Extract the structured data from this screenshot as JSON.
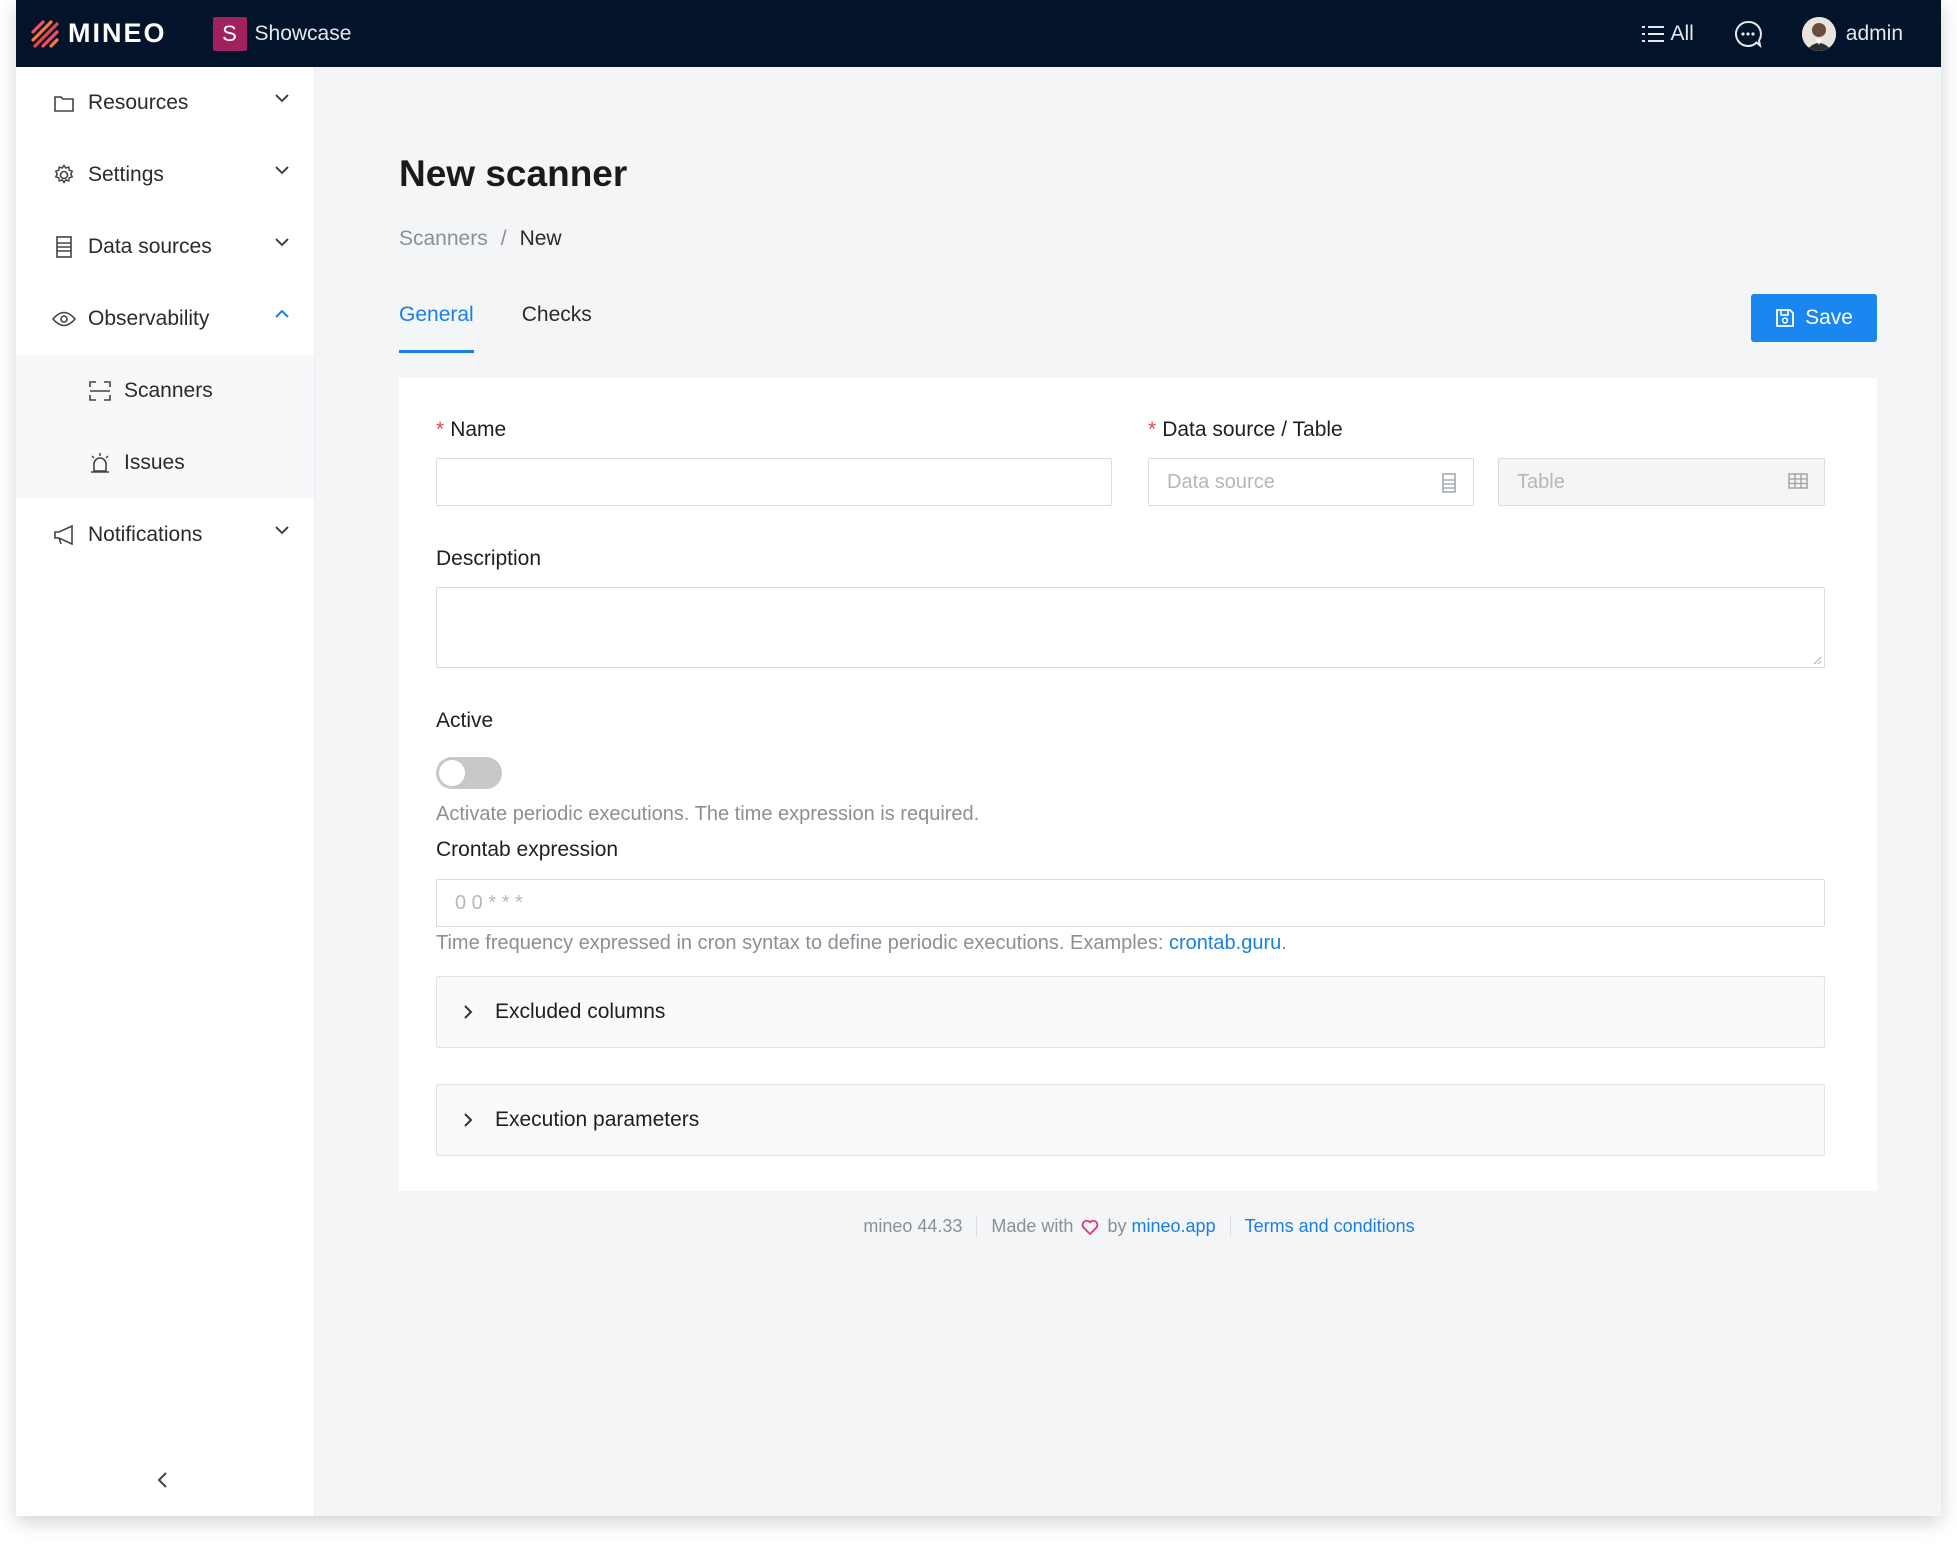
{
  "header": {
    "brand": "MINEO",
    "workspace_badge": "S",
    "workspace_name": "Showcase",
    "filter_label": "All",
    "user_name": "admin"
  },
  "sidebar": {
    "items": [
      {
        "label": "Resources",
        "icon": "folder-icon"
      },
      {
        "label": "Settings",
        "icon": "gear-icon"
      },
      {
        "label": "Data sources",
        "icon": "database-icon"
      },
      {
        "label": "Observability",
        "icon": "eye-icon",
        "expanded": true
      },
      {
        "label": "Notifications",
        "icon": "megaphone-icon"
      }
    ],
    "subitems": [
      {
        "label": "Scanners",
        "icon": "scan-icon"
      },
      {
        "label": "Issues",
        "icon": "alarm-icon"
      }
    ]
  },
  "page": {
    "title": "New scanner",
    "breadcrumb": [
      "Scanners",
      "/",
      "New"
    ],
    "tabs": [
      "General",
      "Checks"
    ],
    "active_tab": "General",
    "save_label": "Save"
  },
  "form": {
    "name_label": "Name",
    "name_value": "",
    "datasource_label": "Data source / Table",
    "datasource_placeholder": "Data source",
    "table_placeholder": "Table",
    "description_label": "Description",
    "active_label": "Active",
    "active_value": false,
    "active_help": "Activate periodic executions. The time expression is required.",
    "crontab_label": "Crontab expression",
    "crontab_placeholder": "0 0 * * *",
    "crontab_help": "Time frequency expressed in cron syntax to define periodic executions. Examples: ",
    "crontab_link": "crontab.guru",
    "crontab_help_end": ".",
    "excluded_label": "Excluded columns",
    "exec_label": "Execution parameters"
  },
  "footer": {
    "version": "mineo 44.33",
    "made_with": "Made with",
    "by": "by",
    "site": "mineo.app",
    "terms": "Terms and conditions"
  },
  "colors": {
    "header_bg": "#03142a",
    "accent": "#1a86f0",
    "workspace": "#a0215e",
    "required": "#e5484d"
  }
}
